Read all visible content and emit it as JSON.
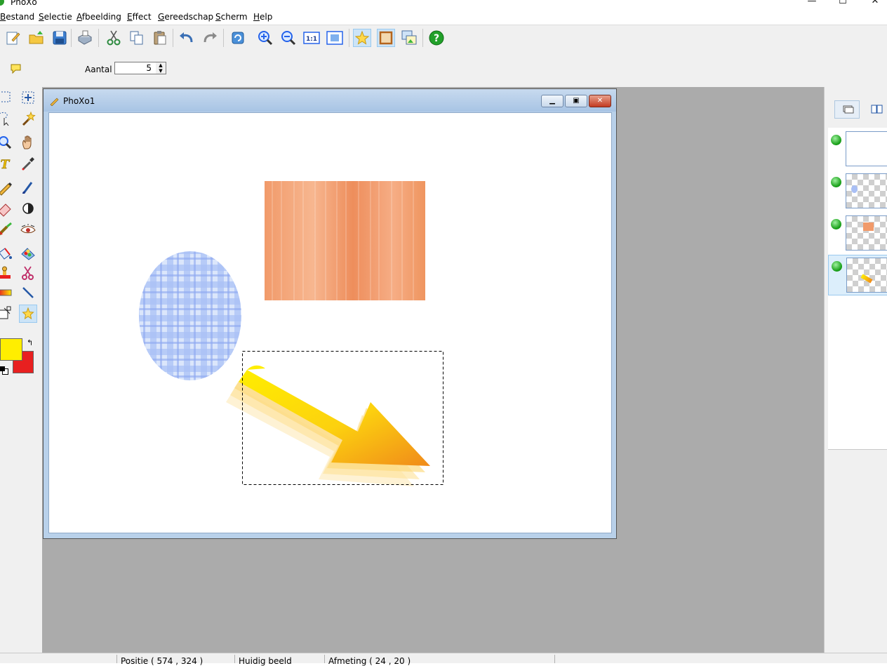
{
  "app": {
    "title": "PhoXo"
  },
  "window_controls": {
    "minimize": "—",
    "maximize": "☐",
    "close": "✕"
  },
  "menu": [
    {
      "pre": "",
      "u": "B",
      "post": "estand"
    },
    {
      "pre": "",
      "u": "S",
      "post": "electie"
    },
    {
      "pre": "",
      "u": "A",
      "post": "fbeelding"
    },
    {
      "pre": "",
      "u": "E",
      "post": "ffect"
    },
    {
      "pre": "",
      "u": "G",
      "post": "ereedschap"
    },
    {
      "pre": "",
      "u": "S",
      "post": "cherm"
    },
    {
      "pre": "",
      "u": "H",
      "post": "elp"
    }
  ],
  "toolbar": {
    "zoom_actual_label": "1:1"
  },
  "options": {
    "aantal_label": "Aantal",
    "aantal_value": "5"
  },
  "document": {
    "title": "PhoXo1"
  },
  "colors": {
    "foreground": "#ffee00",
    "background": "#e82020"
  },
  "status": {
    "position": "Positie ( 574 , 324 )",
    "current_image": "Huidig beeld",
    "size": "Afmeting ( 24 , 20 )"
  }
}
